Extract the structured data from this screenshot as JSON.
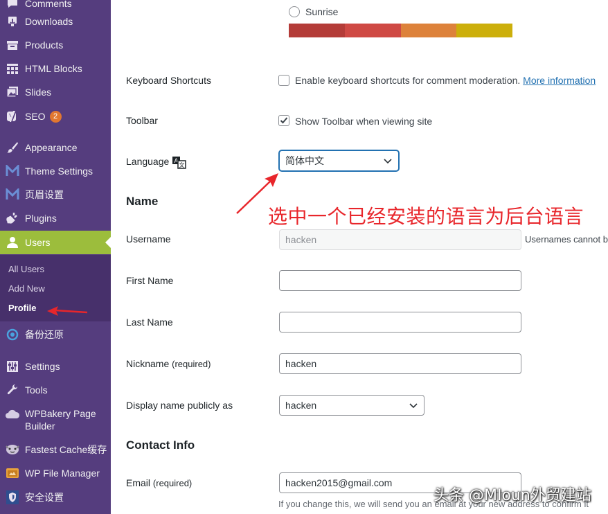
{
  "sidebar": {
    "items": [
      {
        "label": "Comments",
        "icon": "comment-icon"
      },
      {
        "label": "Downloads",
        "icon": "download-icon"
      },
      {
        "label": "Products",
        "icon": "products-icon"
      },
      {
        "label": "HTML Blocks",
        "icon": "grid-icon"
      },
      {
        "label": "Slides",
        "icon": "slides-icon"
      },
      {
        "label": "SEO",
        "icon": "yoast-icon",
        "badge": "2"
      },
      {
        "label": "Appearance",
        "icon": "brush-icon"
      },
      {
        "label": "Theme Settings",
        "icon": "m-logo-icon"
      },
      {
        "label": "页眉设置",
        "icon": "m-logo-icon"
      },
      {
        "label": "Plugins",
        "icon": "plug-icon"
      },
      {
        "label": "Users",
        "icon": "user-icon"
      },
      {
        "label": "备份还原",
        "icon": "backup-icon"
      },
      {
        "label": "Settings",
        "icon": "settings-icon"
      },
      {
        "label": "Tools",
        "icon": "wrench-icon"
      },
      {
        "label": "WPBakery Page",
        "label2": "Builder",
        "icon": "cloud-icon"
      },
      {
        "label": "Fastest Cache缓存",
        "icon": "cheetah-icon"
      },
      {
        "label": "WP File Manager",
        "icon": "folder-icon"
      },
      {
        "label": "安全设置",
        "icon": "shield-icon"
      }
    ],
    "submenu": [
      "All Users",
      "Add New",
      "Profile"
    ],
    "colors": {
      "bg": "#553d7e",
      "active": "#9cbd3c"
    }
  },
  "color_scheme": {
    "option": "Sunrise",
    "swatches": [
      "#b43c38",
      "#cf4944",
      "#dd823b",
      "#ccaf0b"
    ]
  },
  "keyboard": {
    "label": "Keyboard Shortcuts",
    "text": "Enable keyboard shortcuts for comment moderation.",
    "link": "More information"
  },
  "toolbar": {
    "label": "Toolbar",
    "text": "Show Toolbar when viewing site"
  },
  "language": {
    "label": "Language",
    "value": "简体中文"
  },
  "name_section": {
    "title": "Name",
    "username_label": "Username",
    "username_value": "hacken",
    "username_note": "Usernames cannot be",
    "first_label": "First Name",
    "last_label": "Last Name",
    "nick_label": "Nickname",
    "nick_req": "(required)",
    "nick_value": "hacken",
    "display_label": "Display name publicly as",
    "display_value": "hacken"
  },
  "contact": {
    "title": "Contact Info",
    "email_label": "Email",
    "email_req": "(required)",
    "email_value": "hacken2015@gmail.com",
    "email_note": "If you change this, we will send you an email at your new address to confirm it"
  },
  "annotation": "选中一个已经安装的语言为后台语言",
  "watermark": "头条 @MIoun外贸建站"
}
